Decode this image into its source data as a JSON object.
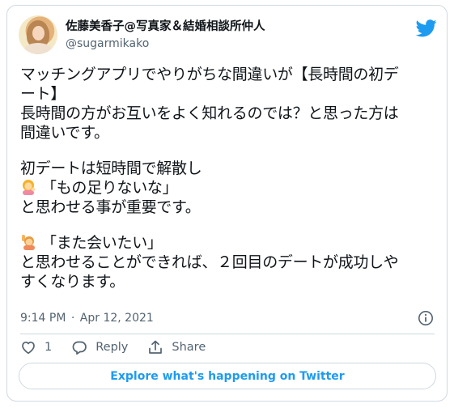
{
  "author": {
    "display_name": "佐藤美香子@写真家＆結婚相談所仲人",
    "handle": "@sugarmikako",
    "avatar_icon": "profile-photo-icon"
  },
  "brand": {
    "logo_icon": "twitter-bird-icon",
    "color": "#1d9bf0"
  },
  "tweet": {
    "lines": [
      "マッチングアプリでやりがちな間違いが【長時間の初デ",
      "ート】",
      "長時間の方がお互いをよく知れるのでは？と思った方は",
      "間違いです。",
      "",
      "初デートは短時間で解散し",
      "「もの足りないな」",
      "と思わせる事が重要です。",
      "",
      "「また会いたい」",
      "と思わせることができれば、２回目のデートが成功しや",
      "すくなります。"
    ],
    "emoji": {
      "line_6": "woman-tipping-hand-emoji",
      "line_9": "person-raising-hand-emoji"
    }
  },
  "meta": {
    "time": "9:14 PM",
    "separator": "·",
    "date": "Apr 12, 2021",
    "info_icon": "info-icon"
  },
  "actions": {
    "like_count": "1",
    "reply_label": "Reply",
    "share_label": "Share"
  },
  "explore": {
    "label": "Explore what's happening on Twitter"
  }
}
